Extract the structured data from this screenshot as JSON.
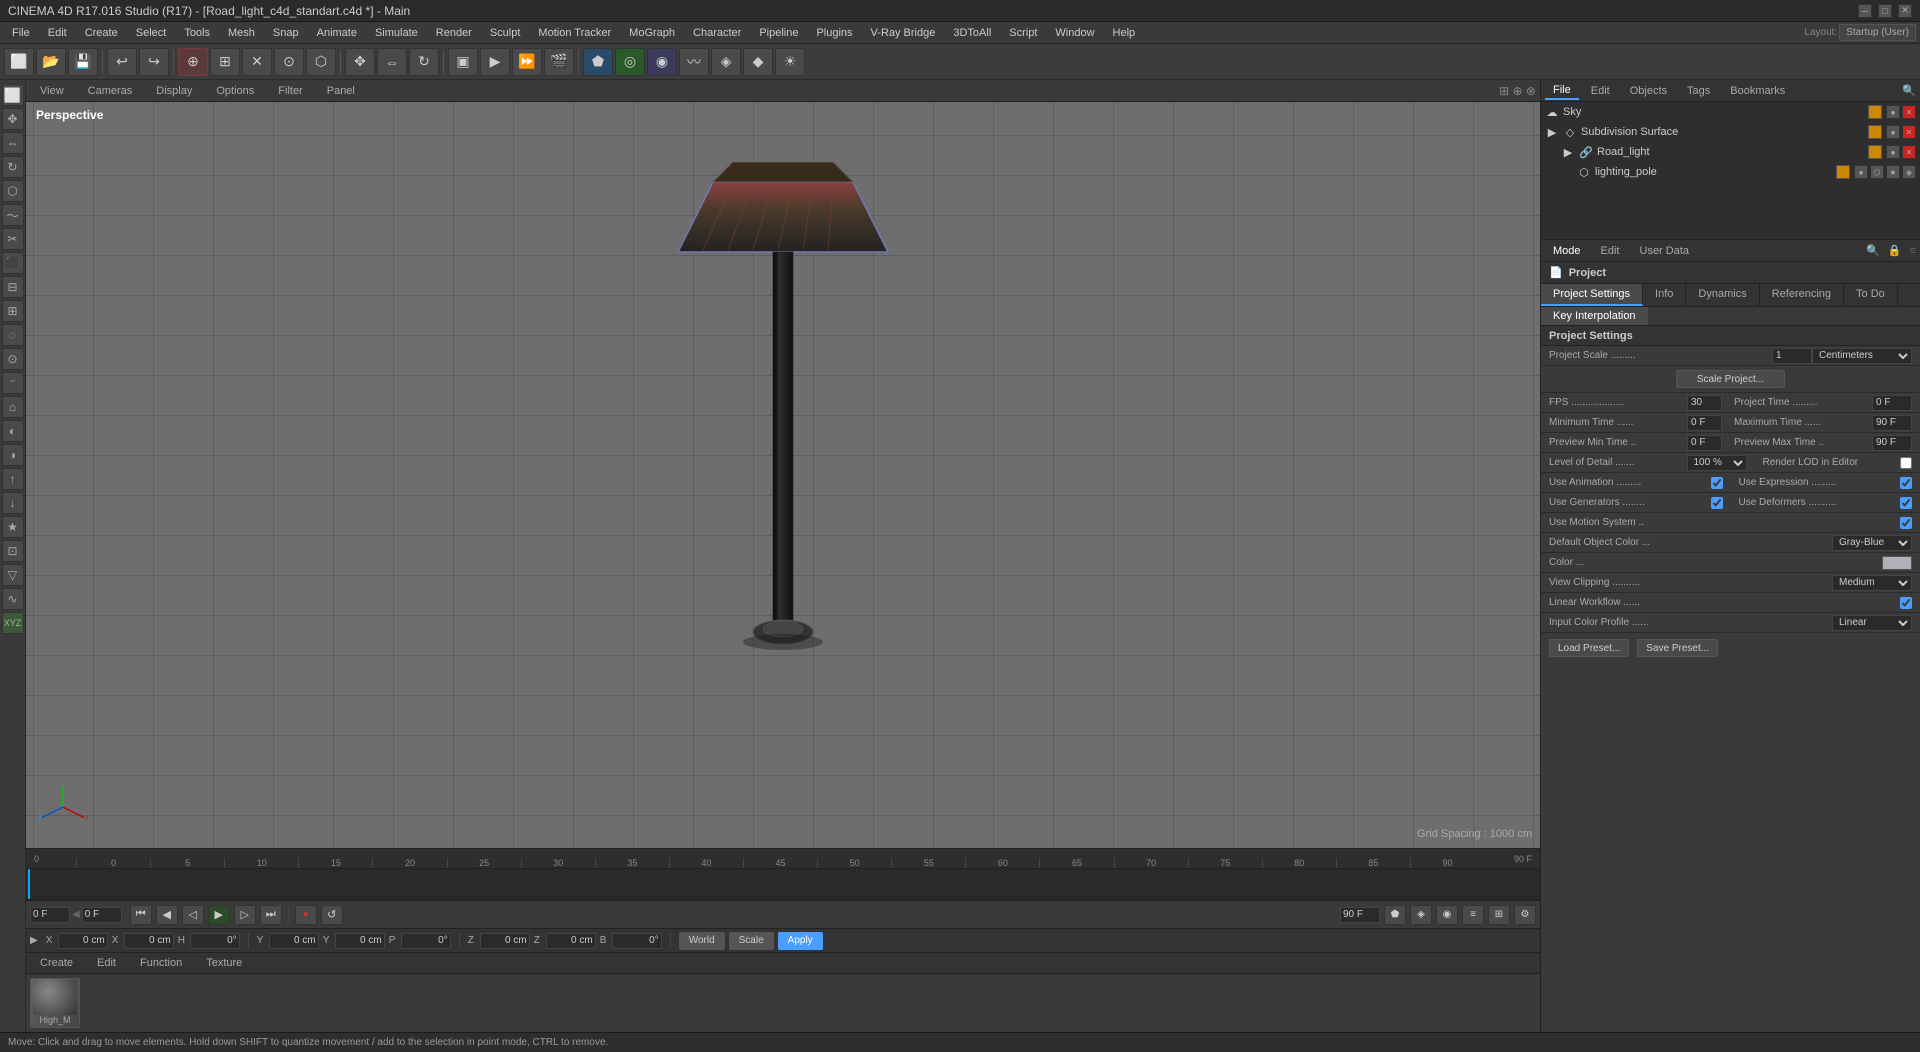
{
  "window": {
    "title": "CINEMA 4D R17.016 Studio (R17) - [Road_light_c4d_standart.c4d *] - Main"
  },
  "menu": {
    "items": [
      "File",
      "Edit",
      "Create",
      "Select",
      "Tools",
      "Mesh",
      "Snap",
      "Animate",
      "Simulate",
      "Render",
      "Sculpt",
      "Motion Tracker",
      "MoGraph",
      "Character",
      "Pipeline",
      "Plugins",
      "V-Ray Bridge",
      "3DToAll",
      "Script",
      "Window",
      "Help"
    ]
  },
  "layout_label": "Layout:",
  "layout_value": "Startup (User)",
  "viewport": {
    "label": "Perspective",
    "tabs": [
      "View",
      "Cameras",
      "Display",
      "Options",
      "Filter",
      "Panel"
    ],
    "grid_spacing": "Grid Spacing : 1000 cm"
  },
  "object_manager": {
    "tabs": [
      "File",
      "Edit",
      "Objects",
      "Tags",
      "Bookmarks"
    ],
    "objects": [
      {
        "name": "Sky",
        "indent": 0,
        "icon": "☁",
        "color": "#cc8800"
      },
      {
        "name": "Subdivision Surface",
        "indent": 0,
        "icon": "◇",
        "color": "#cc8800"
      },
      {
        "name": "Road_light",
        "indent": 1,
        "icon": "🔗",
        "color": "#cc8800"
      },
      {
        "name": "lighting_pole",
        "indent": 2,
        "icon": "⬡",
        "color": "#cc8800"
      }
    ]
  },
  "properties": {
    "mode_tabs": [
      "Mode",
      "Edit",
      "User Data"
    ],
    "panel_title": "Project",
    "project_tabs": [
      "Project Settings",
      "Info",
      "Dynamics",
      "Referencing",
      "To Do"
    ],
    "sub_tabs": [
      "Key Interpolation"
    ],
    "section_title": "Project Settings",
    "fields": {
      "project_scale_label": "Project Scale",
      "project_scale_value": "1",
      "project_scale_unit": "Centimeters",
      "scale_project_btn": "Scale Project...",
      "fps_label": "FPS",
      "fps_value": "30",
      "project_time_label": "Project Time",
      "project_time_value": "0 F",
      "min_time_label": "Minimum Time",
      "min_time_value": "0 F",
      "max_time_label": "Maximum Time",
      "max_time_value": "90 F",
      "preview_min_label": "Preview Min Time",
      "preview_min_value": "0 F",
      "preview_max_label": "Preview Max Time",
      "preview_max_value": "90 F",
      "lod_label": "Level of Detail",
      "lod_value": "100 %",
      "render_lod_label": "Render LOD in Editor",
      "use_animation_label": "Use Animation",
      "use_expression_label": "Use Expression",
      "use_generators_label": "Use Generators",
      "use_deformers_label": "Use Deformers",
      "use_motion_label": "Use Motion System",
      "default_obj_color_label": "Default Object Color",
      "default_obj_color_value": "Gray-Blue",
      "color_label": "Color",
      "view_clipping_label": "View Clipping",
      "view_clipping_value": "Medium",
      "linear_workflow_label": "Linear Workflow",
      "input_color_label": "Input Color Profile",
      "input_color_value": "Linear",
      "load_preset_btn": "Load Preset...",
      "save_preset_btn": "Save Preset..."
    }
  },
  "timeline": {
    "marks": [
      "0",
      "5",
      "10",
      "15",
      "20",
      "25",
      "30",
      "35",
      "40",
      "45",
      "50",
      "55",
      "60",
      "65",
      "70",
      "75",
      "80",
      "85",
      "90"
    ],
    "start": "0 F",
    "end": "90 F",
    "current": "0 F"
  },
  "bottom_panel": {
    "tabs": [
      "Create",
      "Edit",
      "Function",
      "Texture"
    ],
    "material_name": "High_M"
  },
  "coord_bar": {
    "x_label": "X",
    "x_val": "0 cm",
    "x2_label": "X",
    "x2_val": "0 cm",
    "h_label": "H",
    "h_val": "0°",
    "y_label": "Y",
    "y_val": "0 cm",
    "y2_label": "Y",
    "y2_val": "0 cm",
    "p_label": "P",
    "p_val": "0°",
    "z_label": "Z",
    "z_val": "0 cm",
    "z2_label": "Z",
    "z2_val": "0 cm",
    "b_label": "B",
    "b_val": "0°",
    "world_btn": "World",
    "scale_btn": "Scale",
    "apply_btn": "Apply"
  },
  "status_bar": {
    "text": "Move: Click and drag to move elements. Hold down SHIFT to quantize movement / add to the selection in point mode, CTRL to remove."
  },
  "icons": {
    "close": "✕",
    "minimize": "─",
    "maximize": "□",
    "arrow_right": "▶",
    "triangle_down": "▼",
    "triangle_right": "▶",
    "check": "✓",
    "dot": "●",
    "move": "✥",
    "rotate": "↻",
    "scale": "⇔",
    "render": "▶",
    "rewind": "⏮",
    "play": "▶",
    "step_back": "◀",
    "step_fwd": "▶",
    "fast_fwd": "⏭",
    "record": "●",
    "loop": "↺"
  }
}
